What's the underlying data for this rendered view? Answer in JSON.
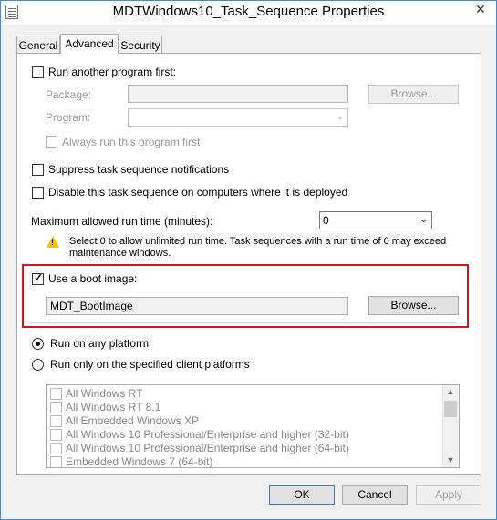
{
  "window": {
    "title": "MDTWindows10_Task_Sequence Properties",
    "close_glyph": "✕"
  },
  "tabs": [
    {
      "label": "General",
      "active": false
    },
    {
      "label": "Advanced",
      "active": true
    },
    {
      "label": "Security",
      "active": false
    }
  ],
  "run_another": {
    "label": "Run another program first:",
    "checked": false,
    "package_label": "Package:",
    "package_value": "",
    "program_label": "Program:",
    "program_value": "",
    "browse_label": "Browse...",
    "always_run_label": "Always run this program first"
  },
  "suppress": {
    "label": "Suppress task sequence notifications",
    "checked": false
  },
  "disable": {
    "label": "Disable this task sequence on computers where it is deployed",
    "checked": false
  },
  "max_runtime": {
    "label": "Maximum allowed run time (minutes):",
    "value": "0",
    "warning_line1": "Select 0 to allow unlimited run time. Task sequences with a run time of 0 may exceed",
    "warning_line2": "maintenance windows."
  },
  "boot_image": {
    "label": "Use a boot image:",
    "checked": true,
    "value": "MDT_BootImage",
    "browse_label": "Browse..."
  },
  "platform": {
    "any_label": "Run on any platform",
    "specified_label": "Run only on the specified client platforms",
    "selected": "any"
  },
  "platform_list": [
    "All Windows RT",
    "All Windows RT 8.1",
    "All Embedded Windows XP",
    "All Windows 10 Professional/Enterprise and higher (32-bit)",
    "All Windows 10 Professional/Enterprise and higher (64-bit)",
    "Embedded Windows 7 (64-bit)"
  ],
  "buttons": {
    "ok": "OK",
    "cancel": "Cancel",
    "apply": "Apply"
  },
  "colors": {
    "highlight": "#d0171b",
    "warning": "#f6c400",
    "title_border": "#3c8dd4"
  }
}
